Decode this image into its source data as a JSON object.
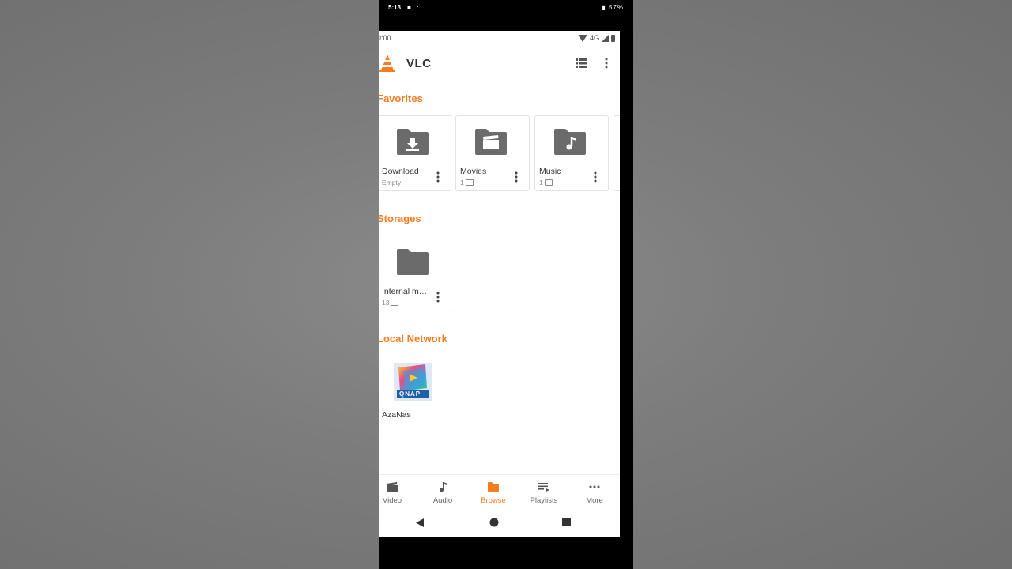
{
  "outer_status": {
    "time": "5:13",
    "battery": "57%"
  },
  "inner_status": {
    "time": "0:00",
    "network": "4G"
  },
  "app": {
    "title": "VLC"
  },
  "sections": {
    "favorites": {
      "title": "Favorites",
      "items": [
        {
          "label": "Download",
          "sub": "Empty",
          "icon": "download-folder-icon"
        },
        {
          "label": "Movies",
          "sub": "1",
          "icon": "movies-folder-icon"
        },
        {
          "label": "Music",
          "sub": "1",
          "icon": "music-folder-icon"
        }
      ]
    },
    "storages": {
      "title": "Storages",
      "items": [
        {
          "label": "Internal m…",
          "sub": "13",
          "icon": "folder-icon"
        }
      ]
    },
    "local_network": {
      "title": "Local Network",
      "items": [
        {
          "label": "AzaNas",
          "logo_text": "QNAP",
          "icon": "qnap-logo-icon"
        }
      ]
    }
  },
  "bottom_nav": [
    {
      "label": "Video",
      "icon": "video-icon"
    },
    {
      "label": "Audio",
      "icon": "audio-icon"
    },
    {
      "label": "Browse",
      "icon": "browse-folder-icon",
      "active": true
    },
    {
      "label": "Playlists",
      "icon": "playlist-icon"
    },
    {
      "label": "More",
      "icon": "more-horizontal-icon"
    }
  ],
  "colors": {
    "accent": "#f57c1f",
    "folder": "#6b6b6b",
    "text": "#333333"
  }
}
